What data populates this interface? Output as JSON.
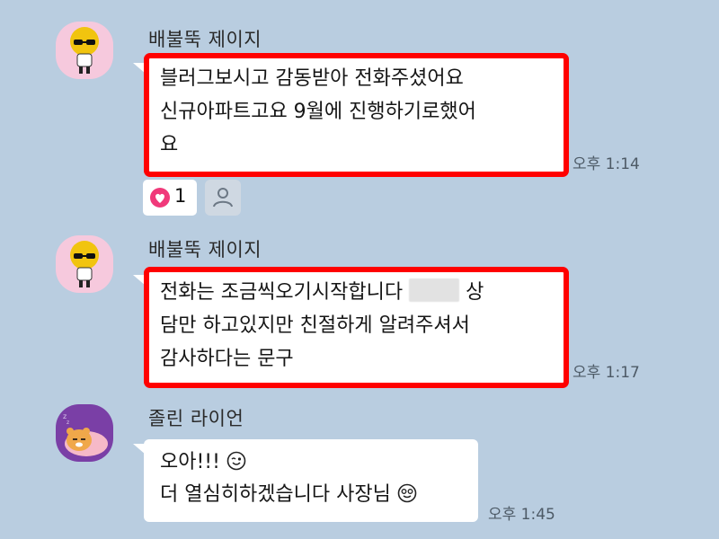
{
  "messages": [
    {
      "sender": "배불뚝 제이지",
      "lines": [
        "블러그보시고 감동받아 전화주셨어요",
        "신규아파트고요 9월에 진행하기로했어",
        "요"
      ],
      "time": "오후 1:14",
      "avatar_icon": "muzi-avatar-icon",
      "reactions": {
        "like_count": "1"
      }
    },
    {
      "sender": "배불뚝 제이지",
      "line1_before": "전화는 조금씩오기시작합니다",
      "line1_after": "상",
      "line2": "담만 하고있지만 친절하게 알려주셔서",
      "line3": "감사하다는 문구",
      "time": "오후 1:17",
      "avatar_icon": "muzi-avatar-icon"
    },
    {
      "sender": "졸린 라이언",
      "line1": "오아!!!",
      "line2": "더 열심히하겠습니다 사장님",
      "time": "오후 1:45",
      "avatar_icon": "ryan-avatar-icon"
    }
  ],
  "colors": {
    "background": "#b9cde0",
    "highlight": "#ff0000",
    "bubble": "#ffffff",
    "heart": "#f0397a"
  }
}
